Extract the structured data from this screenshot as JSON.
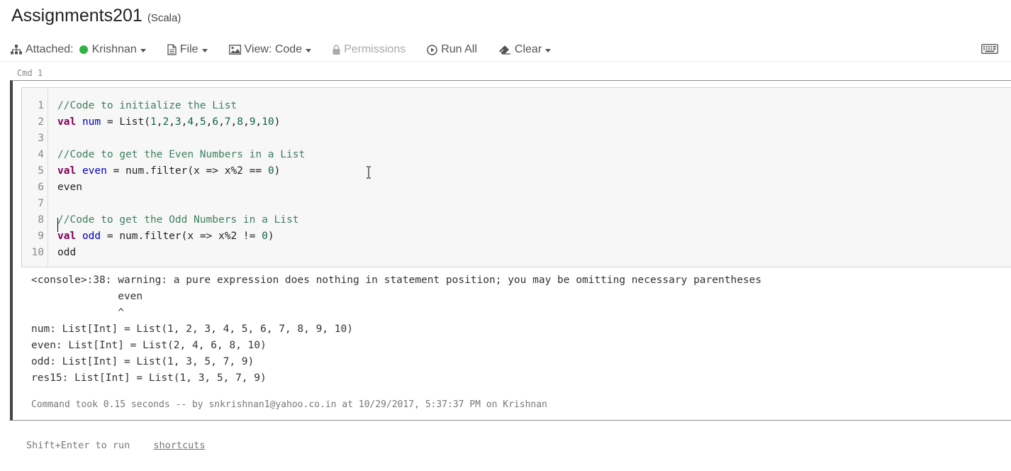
{
  "notebook": {
    "title": "Assignments201",
    "language": "(Scala)"
  },
  "toolbar": {
    "attached_label": "Attached:",
    "cluster_name": "Krishnan",
    "file_label": "File",
    "view_label": "View: Code",
    "permissions_label": "Permissions",
    "run_all_label": "Run All",
    "clear_label": "Clear",
    "status_color": "#2fb344"
  },
  "cell": {
    "cmd_label": "Cmd 1",
    "line_numbers": [
      "1",
      "2",
      "3",
      "4",
      "5",
      "6",
      "7",
      "8",
      "9",
      "10"
    ],
    "code_lines": [
      "//Code to initialize the List",
      "val num = List(1,2,3,4,5,6,7,8,9,10)",
      "",
      "//Code to get the Even Numbers in a List",
      "val even = num.filter(x => x%2 == 0)",
      "even",
      "",
      "//Code to get the Odd Numbers in a List",
      "val odd = num.filter(x => x%2 != 0)",
      "odd"
    ],
    "output_lines": [
      "<console>:38: warning: a pure expression does nothing in statement position; you may be omitting necessary parentheses",
      "              even",
      "              ^",
      "num: List[Int] = List(1, 2, 3, 4, 5, 6, 7, 8, 9, 10)",
      "even: List[Int] = List(2, 4, 6, 8, 10)",
      "odd: List[Int] = List(1, 3, 5, 7, 9)",
      "res15: List[Int] = List(1, 3, 5, 7, 9)"
    ],
    "footer": "Command took 0.15 seconds -- by snkrishnan1@yahoo.co.in at 10/29/2017, 5:37:37 PM on Krishnan"
  },
  "hints": {
    "run_hint": "Shift+Enter to run",
    "shortcuts_link": "shortcuts"
  }
}
